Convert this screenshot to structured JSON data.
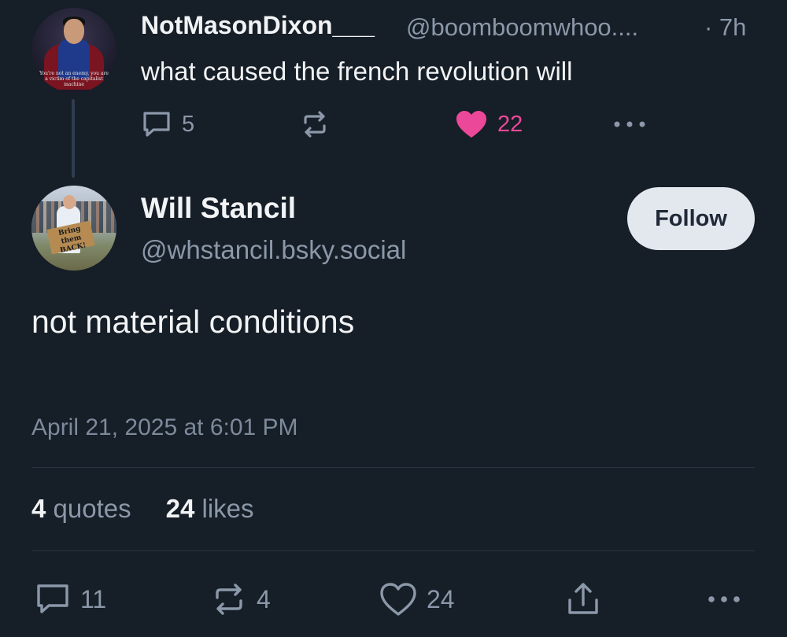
{
  "colors": {
    "background": "#161e27",
    "text_primary": "#f1f3f5",
    "text_secondary": "#8b98a9",
    "like_pink": "#ec4899",
    "follow_button_bg": "#e3e8ee"
  },
  "parent_post": {
    "display_name": "NotMasonDixon___",
    "handle": "@boomboomwhoo....",
    "time": "· 7h",
    "text": "what caused the french revolution will",
    "avatar_caption": "You're not an enemy, you are a victim of the capitalist machine",
    "actions": {
      "reply_icon": "reply-icon",
      "replies": "5",
      "repost_icon": "repost-icon",
      "like_icon": "heart-filled-icon",
      "likes": "22",
      "more_icon": "more-icon"
    }
  },
  "main_post": {
    "display_name": "Will Stancil",
    "handle": "@whstancil.bsky.social",
    "follow_label": "Follow",
    "avatar_sign": "Bring them BACK!",
    "text": "not material conditions",
    "timestamp": "April 21, 2025 at 6:01 PM",
    "stats": {
      "quotes_count": "4",
      "quotes_label": "quotes",
      "likes_count": "24",
      "likes_label": "likes"
    },
    "actions": {
      "reply_icon": "reply-icon",
      "replies": "11",
      "repost_icon": "repost-icon",
      "reposts": "4",
      "like_icon": "heart-outline-icon",
      "likes": "24",
      "share_icon": "share-icon",
      "more_icon": "more-icon"
    }
  }
}
